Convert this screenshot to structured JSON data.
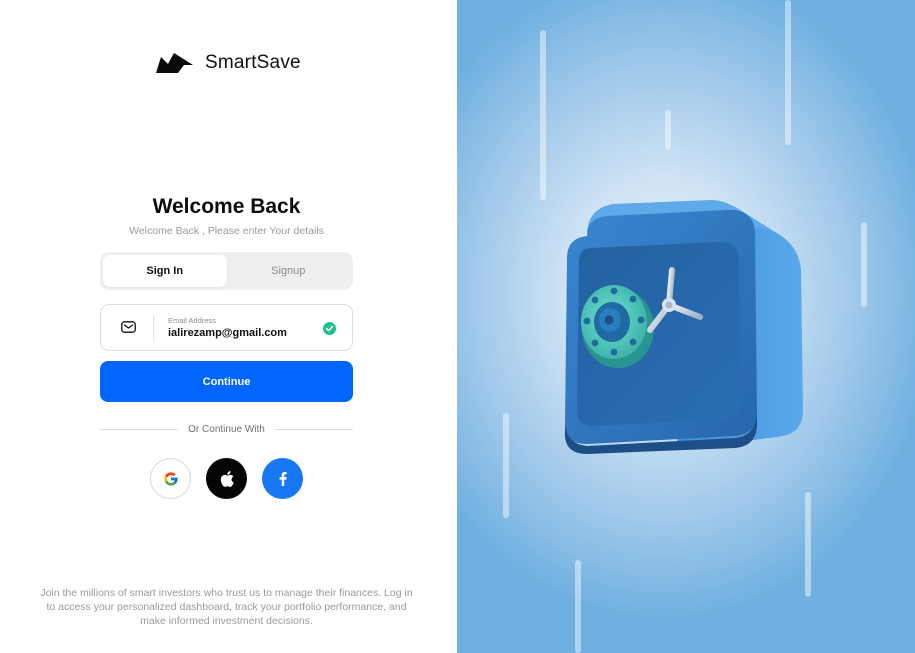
{
  "brand": {
    "name": "SmartSave"
  },
  "auth": {
    "title": "Welcome Back",
    "subtitle": "Welcome Back , Please enter Your details",
    "tabs": [
      {
        "label": "Sign In",
        "active": true
      },
      {
        "label": "Signup",
        "active": false
      }
    ],
    "email": {
      "label": "Email Address",
      "value": "ialirezamp@gmail.com",
      "valid": true
    },
    "continue_label": "Continue",
    "divider_text": "Or Continue With",
    "social": [
      {
        "name": "google-icon"
      },
      {
        "name": "apple-icon"
      },
      {
        "name": "facebook-icon"
      }
    ],
    "footer_text": "Join the millions of smart investors who trust us to manage their finances. Log in to access your personalized dashboard, track your portfolio performance, and make informed investment decisions."
  },
  "colors": {
    "primary": "#0066ff",
    "success": "#1fbf8f",
    "facebook": "#1877f2",
    "safe_body": "#2f78c4"
  }
}
